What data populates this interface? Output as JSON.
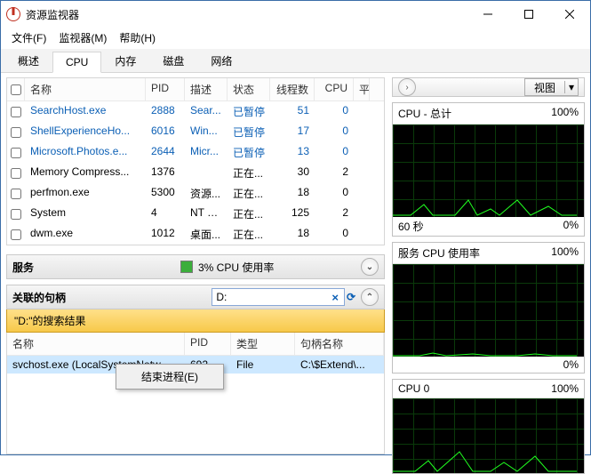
{
  "window": {
    "title": "资源监视器"
  },
  "menu": {
    "file": "文件(F)",
    "monitor": "监视器(M)",
    "help": "帮助(H)"
  },
  "tabs": {
    "overview": "概述",
    "cpu": "CPU",
    "memory": "内存",
    "disk": "磁盘",
    "network": "网络"
  },
  "proc": {
    "headers": {
      "name": "名称",
      "pid": "PID",
      "desc": "描述",
      "status": "状态",
      "threads": "线程数",
      "cpu": "CPU",
      "avg": "平"
    },
    "rows": [
      {
        "name": "SearchHost.exe",
        "pid": "2888",
        "desc": "Sear...",
        "status": "已暂停",
        "threads": "51",
        "cpu": "0",
        "blue": true
      },
      {
        "name": "ShellExperienceHo...",
        "pid": "6016",
        "desc": "Win...",
        "status": "已暂停",
        "threads": "17",
        "cpu": "0",
        "blue": true
      },
      {
        "name": "Microsoft.Photos.e...",
        "pid": "2644",
        "desc": "Micr...",
        "status": "已暂停",
        "threads": "13",
        "cpu": "0",
        "blue": true
      },
      {
        "name": "Memory Compress...",
        "pid": "1376",
        "desc": "",
        "status": "正在...",
        "threads": "30",
        "cpu": "2",
        "blue": false
      },
      {
        "name": "perfmon.exe",
        "pid": "5300",
        "desc": "资源...",
        "status": "正在...",
        "threads": "18",
        "cpu": "0",
        "blue": false
      },
      {
        "name": "System",
        "pid": "4",
        "desc": "NT K...",
        "status": "正在...",
        "threads": "125",
        "cpu": "2",
        "blue": false
      },
      {
        "name": "dwm.exe",
        "pid": "1012",
        "desc": "桌面...",
        "status": "正在...",
        "threads": "18",
        "cpu": "0",
        "blue": false
      }
    ]
  },
  "services": {
    "title": "服务",
    "cpu": "3% CPU 使用率"
  },
  "handles": {
    "title": "关联的句柄",
    "search_value": "D:",
    "scope": "\"D:\"的搜索结果",
    "headers": {
      "name": "名称",
      "pid": "PID",
      "type": "类型",
      "hname": "句柄名称"
    },
    "row": {
      "name": "svchost.exe (LocalSystemNetw",
      "pid": "692",
      "type": "File",
      "hname": "C:\\$Extend\\..."
    }
  },
  "context": {
    "end": "结束进程(E)"
  },
  "right": {
    "view": "视图",
    "g1": {
      "title": "CPU - 总计",
      "right": "100%",
      "foot_l": "60 秒",
      "foot_r": "0%"
    },
    "g2": {
      "title": "服务 CPU 使用率",
      "right": "100%",
      "foot_l": "",
      "foot_r": "0%"
    },
    "g3": {
      "title": "CPU 0",
      "right": "100%"
    }
  }
}
